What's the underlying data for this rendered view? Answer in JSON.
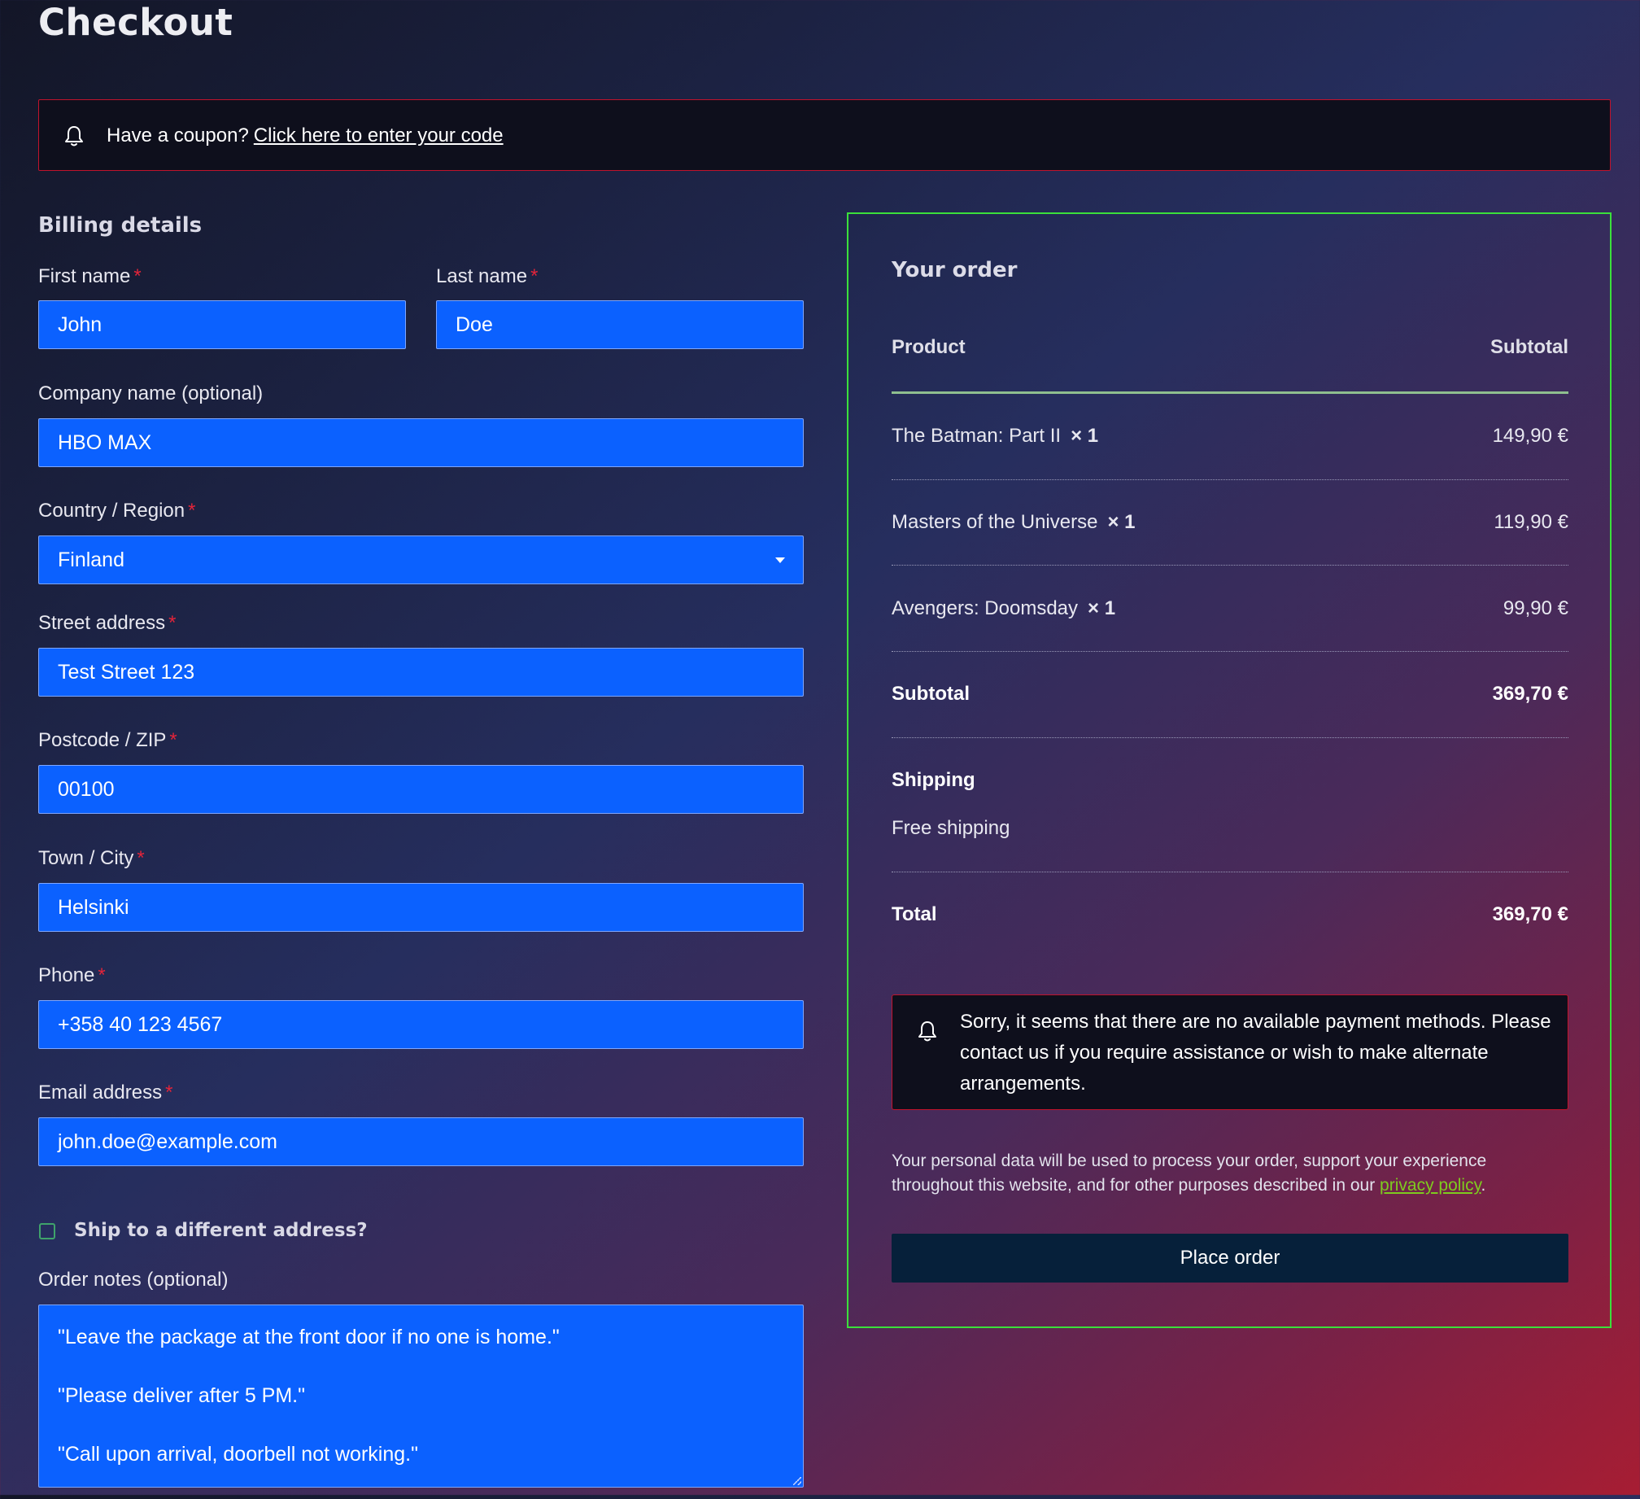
{
  "page": {
    "title": "Checkout"
  },
  "coupon": {
    "prompt": "Have a coupon?",
    "link_label": "Click here to enter your code"
  },
  "billing": {
    "heading": "Billing details",
    "required_marker": "*",
    "fields": {
      "first_name": {
        "label": "First name",
        "value": "John"
      },
      "last_name": {
        "label": "Last name",
        "value": "Doe"
      },
      "company": {
        "label": "Company name (optional)",
        "value": "HBO MAX"
      },
      "country": {
        "label": "Country / Region",
        "value": "Finland"
      },
      "street": {
        "label": "Street address",
        "value": "Test Street 123"
      },
      "postcode": {
        "label": "Postcode / ZIP",
        "value": "00100"
      },
      "city": {
        "label": "Town / City",
        "value": "Helsinki"
      },
      "phone": {
        "label": "Phone",
        "value": "+358 40 123 4567"
      },
      "email": {
        "label": "Email address",
        "value": "john.doe@example.com"
      }
    },
    "ship_different": {
      "label": "Ship to a different address?",
      "checked": false
    },
    "order_notes": {
      "label": "Order notes (optional)",
      "lines": [
        "\"Leave the package at the front door if no one is home.\"",
        "\"Please deliver after 5 PM.\"",
        "\"Call upon arrival, doorbell not working.\""
      ]
    }
  },
  "order": {
    "title": "Your order",
    "columns": {
      "product": "Product",
      "subtotal": "Subtotal"
    },
    "items": [
      {
        "name": "The Batman: Part II",
        "qty": "× 1",
        "price": "149,90 €"
      },
      {
        "name": "Masters of the Universe",
        "qty": "× 1",
        "price": "119,90 €"
      },
      {
        "name": "Avengers: Doomsday",
        "qty": "× 1",
        "price": "99,90 €"
      }
    ],
    "subtotal": {
      "label": "Subtotal",
      "value": "369,70 €"
    },
    "shipping": {
      "label": "Shipping",
      "value": "Free shipping"
    },
    "total": {
      "label": "Total",
      "value": "369,70 €"
    },
    "payment_notice": "Sorry, it seems that there are no available payment methods. Please contact us if you require assistance or wish to make alternate arrangements.",
    "privacy": {
      "text": "Your personal data will be used to process your order, support your experience throughout this website, and for other purposes described in our",
      "link_label": "privacy policy",
      "suffix": "."
    },
    "place_order_label": "Place order"
  },
  "icons": {
    "coupon_notice": "bell-icon",
    "payment_notice": "bell-icon",
    "country_select": "chevron-down-icon"
  },
  "colors": {
    "input_background": "#0b61ff",
    "required_asterisk": "#e2243a",
    "notice_border": "#c0132c",
    "order_panel_border": "#3be03b",
    "privacy_link": "#7ecb1f",
    "place_order_button": "#06203a"
  }
}
